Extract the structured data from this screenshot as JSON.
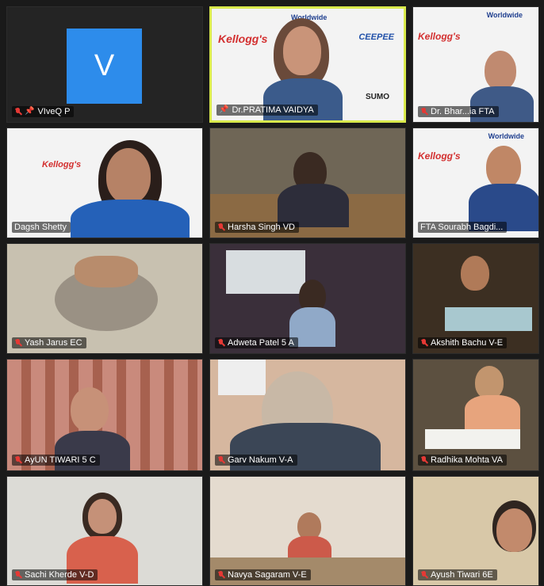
{
  "participants": [
    {
      "name": "VIveQ P",
      "avatar_letter": "V",
      "mic_muted": true,
      "pinned": true
    },
    {
      "name": "Dr.PRATIMA VAIDYA",
      "mic_muted": false,
      "pinned": true,
      "active_speaker": true
    },
    {
      "name": "Dr. Bhar...ia FTA",
      "mic_muted": true
    },
    {
      "name": "Dagsh Shetty",
      "mic_muted": false
    },
    {
      "name": "Harsha Singh VD",
      "mic_muted": true
    },
    {
      "name": "FTA Sourabh Bagdi...",
      "mic_muted": false
    },
    {
      "name": "Yash Jarus EC",
      "mic_muted": true
    },
    {
      "name": "Adweta Patel 5 A",
      "mic_muted": true
    },
    {
      "name": "Akshith Bachu V-E",
      "mic_muted": true
    },
    {
      "name": "AyUN TIWARI 5 C",
      "mic_muted": true
    },
    {
      "name": "Garv Nakum V-A",
      "mic_muted": true
    },
    {
      "name": "Radhika Mohta VA",
      "mic_muted": true
    },
    {
      "name": "Sachi Kherde V-D",
      "mic_muted": true
    },
    {
      "name": "Navya Sagaram V-E",
      "mic_muted": true
    },
    {
      "name": "Ayush Tiwari 6E",
      "mic_muted": true
    }
  ],
  "banner": {
    "brand": "Kellogg's",
    "worldwide": "Worldwide",
    "sponsor1": "CEEPEE",
    "sponsor2": "SUMO"
  }
}
